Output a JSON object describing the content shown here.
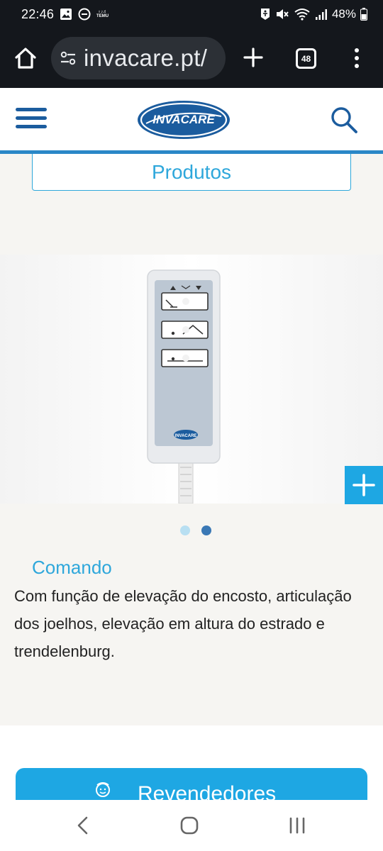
{
  "status_bar": {
    "time": "22:46",
    "left_icons": [
      "image-icon",
      "do-not-disturb-icon",
      "temu-icon"
    ],
    "temu_label": "TEMU",
    "right_icons": [
      "accessibility-icon",
      "mute-icon",
      "wifi-icon",
      "signal-icon",
      "battery-icon"
    ],
    "battery": "48%"
  },
  "browser": {
    "url": "invacare.pt/",
    "tab_count": "48"
  },
  "header": {
    "logo_text": "INVACARE",
    "brand_color": "#1b5c9e"
  },
  "content": {
    "produtos_label": "Produtos",
    "caption_title": "Comando",
    "caption_text": "Com função de elevação do encosto, articulação dos joelhos, elevação em altura do estrado e trendelenburg.",
    "remote_logo_text": "INVACARE",
    "carousel": {
      "active_index": 1,
      "total": 2
    },
    "resellers_label": "Revendedores",
    "accent_color": "#1ea7e3"
  }
}
